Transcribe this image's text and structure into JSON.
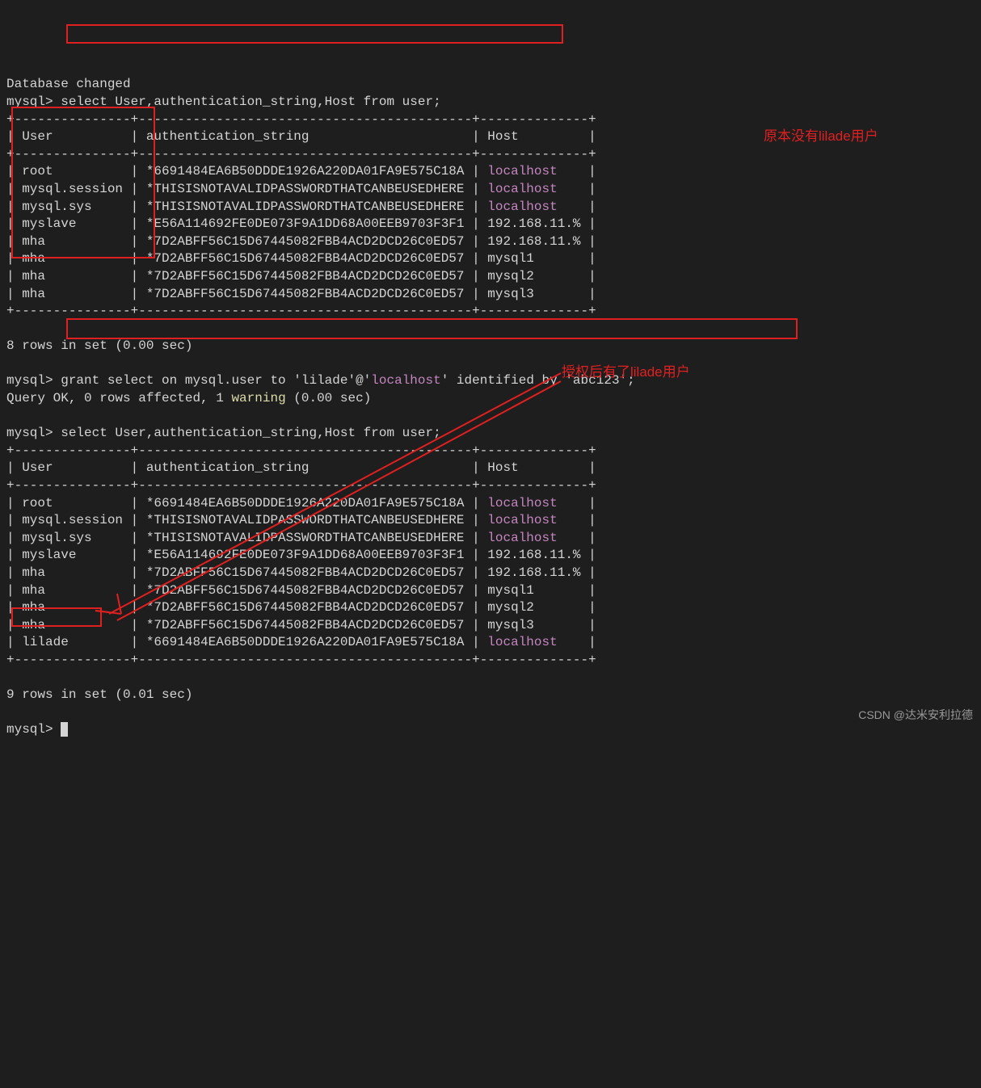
{
  "line_db_changed": "Database changed",
  "prompt": "mysql>",
  "query1": " select User,authentication_string,Host from user;",
  "tbl_border_top": "+---------------+-------------------------------------------+--------------+",
  "tbl_header": "| User          | authentication_string                     | Host         |",
  "tbl_border_mid": "+---------------+-------------------------------------------+--------------+",
  "rows1": {
    "r0_a": "| root          | *6691484EA6B50DDDE1926A220DA01FA9E575C18A | ",
    "r0_h": "localhost",
    "r0_c": "    |",
    "r1_a": "| mysql.session | *THISISNOTAVALIDPASSWORDTHATCANBEUSEDHERE | ",
    "r1_h": "localhost",
    "r1_c": "    |",
    "r2_a": "| mysql.sys     | *THISISNOTAVALIDPASSWORDTHATCANBEUSEDHERE | ",
    "r2_h": "localhost",
    "r2_c": "    |",
    "r3_a": "| myslave       | *E56A114692FE0DE073F9A1DD68A00EEB9703F3F1 | 192.168.11.% |",
    "r4_a": "| mha           | *7D2ABFF56C15D67445082FBB4ACD2DCD26C0ED57 | 192.168.11.% |",
    "r5_a": "| mha           | *7D2ABFF56C15D67445082FBB4ACD2DCD26C0ED57 | mysql1       |",
    "r6_a": "| mha           | *7D2ABFF56C15D67445082FBB4ACD2DCD26C0ED57 | mysql2       |",
    "r7_a": "| mha           | *7D2ABFF56C15D67445082FBB4ACD2DCD26C0ED57 | mysql3       |"
  },
  "tbl_border_bot": "+---------------+-------------------------------------------+--------------+",
  "result1": "8 rows in set (0.00 sec)",
  "grant_a": " grant select on mysql.user to 'lilade'@'",
  "grant_host": "localhost",
  "grant_b": "' identified by 'abc123';",
  "grant_res_a": "Query OK, 0 rows affected, 1 ",
  "grant_res_warn": "warning",
  "grant_res_b": " (0.00 sec)",
  "query2": " select User,authentication_string,Host from user;",
  "rows2": {
    "r0_a": "| root          | *6691484EA6B50DDDE1926A220DA01FA9E575C18A | ",
    "r0_h": "localhost",
    "r0_c": "    |",
    "r1_a": "| mysql.session | *THISISNOTAVALIDPASSWORDTHATCANBEUSEDHERE | ",
    "r1_h": "localhost",
    "r1_c": "    |",
    "r2_a": "| mysql.sys     | *THISISNOTAVALIDPASSWORDTHATCANBEUSEDHERE | ",
    "r2_h": "localhost",
    "r2_c": "    |",
    "r3_a": "| myslave       | *E56A114692FE0DE073F9A1DD68A00EEB9703F3F1 | 192.168.11.% |",
    "r4_a": "| mha           | *7D2ABFF56C15D67445082FBB4ACD2DCD26C0ED57 | 192.168.11.% |",
    "r5_a": "| mha           | *7D2ABFF56C15D67445082FBB4ACD2DCD26C0ED57 | mysql1       |",
    "r6_a": "| mha           | *7D2ABFF56C15D67445082FBB4ACD2DCD26C0ED57 | mysql2       |",
    "r7_a": "| mha           | *7D2ABFF56C15D67445082FBB4ACD2DCD26C0ED57 | mysql3       |",
    "r8_a": "| lilade        | *6691484EA6B50DDDE1926A220DA01FA9E575C18A | ",
    "r8_h": "localhost",
    "r8_c": "    |"
  },
  "result2": "9 rows in set (0.01 sec)",
  "annot1": "原本没有lilade用户",
  "annot2": "授权后有了lilade用户",
  "watermark": "CSDN @达米安利拉德"
}
